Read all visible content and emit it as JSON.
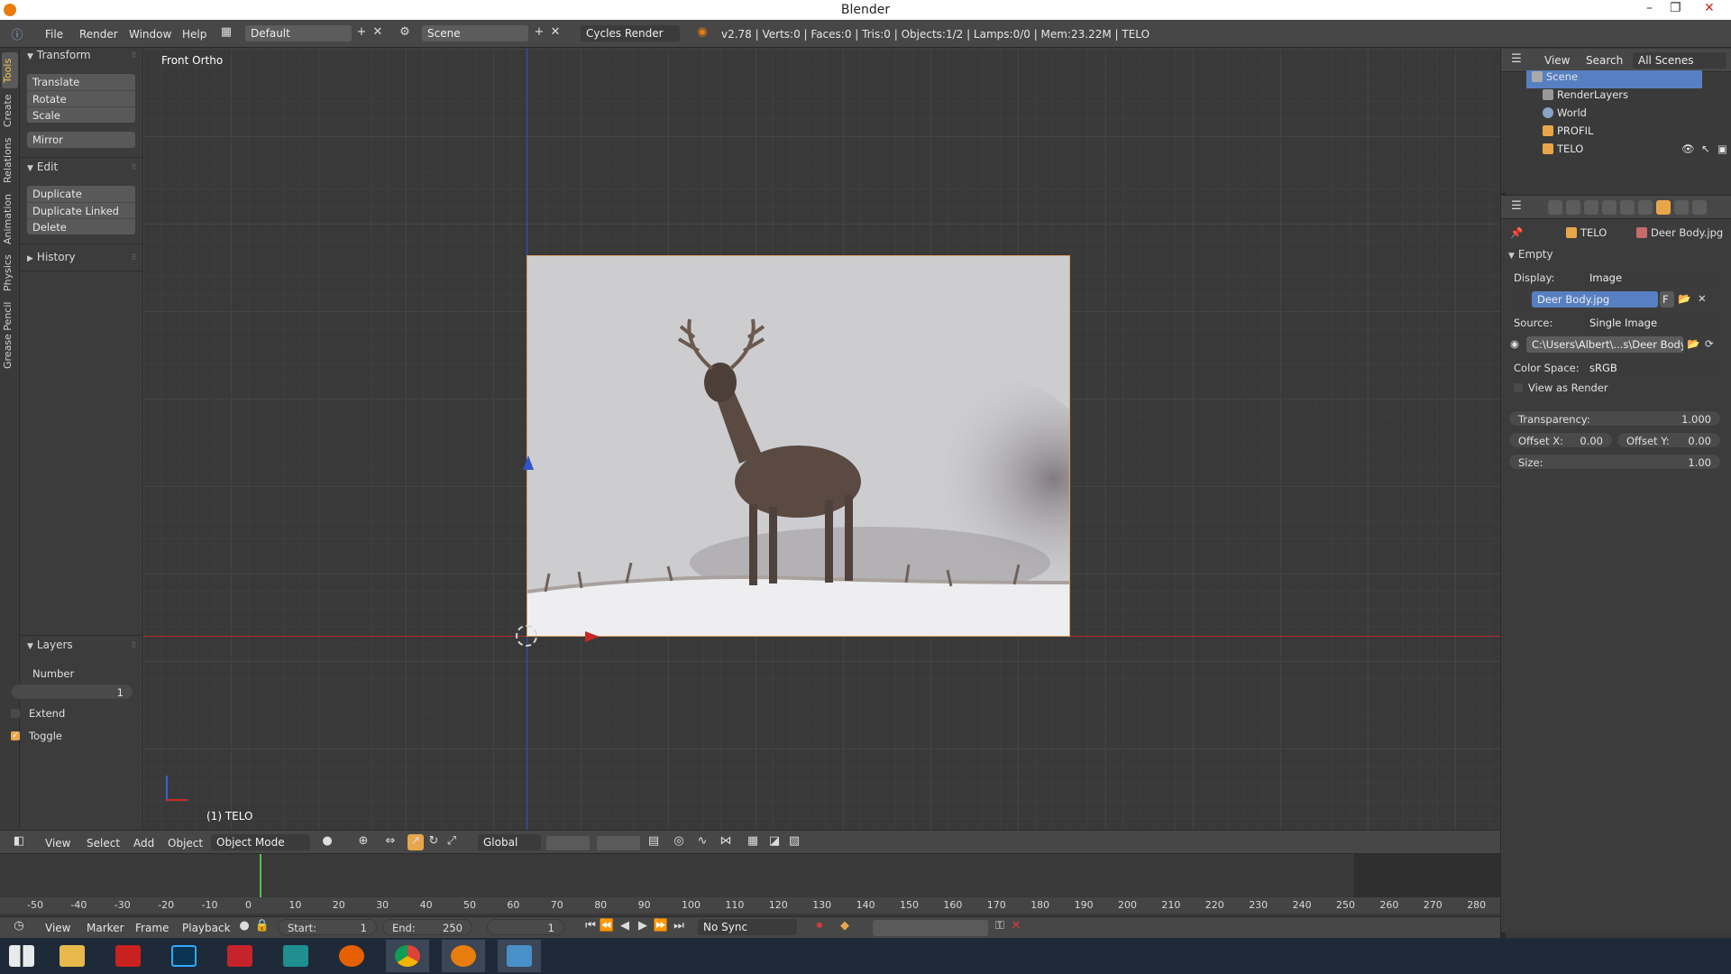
{
  "window": {
    "title": "Blender"
  },
  "menubar": {
    "items": [
      "File",
      "Render",
      "Window",
      "Help"
    ],
    "layout": "Default",
    "scene": "Scene",
    "engine": "Cycles Render",
    "stats": "v2.78 | Verts:0 | Faces:0 | Tris:0 | Objects:1/2 | Lamps:0/0 | Mem:23.22M | TELO"
  },
  "tool_tabs": [
    "Tools",
    "Create",
    "Relations",
    "Animation",
    "Physics",
    "Grease Pencil"
  ],
  "toolshelf": {
    "transform": {
      "title": "Transform",
      "buttons": [
        "Translate",
        "Rotate",
        "Scale",
        "Mirror"
      ]
    },
    "edit": {
      "title": "Edit",
      "buttons": [
        "Duplicate",
        "Duplicate Linked",
        "Delete"
      ]
    },
    "history": {
      "title": "History"
    },
    "layers": {
      "title": "Layers",
      "number_label": "Number",
      "number_value": "1",
      "extend": "Extend",
      "toggle": "Toggle"
    }
  },
  "viewport": {
    "view_label": "Front Ortho",
    "object_label": "(1) TELO"
  },
  "view3d_header": {
    "menus": [
      "View",
      "Select",
      "Add",
      "Object"
    ],
    "mode": "Object Mode",
    "orientation": "Global"
  },
  "timeline": {
    "ticks": [
      "-50",
      "-40",
      "-30",
      "-20",
      "-10",
      "0",
      "10",
      "20",
      "30",
      "40",
      "50",
      "60",
      "70",
      "80",
      "90",
      "100",
      "110",
      "120",
      "130",
      "140",
      "150",
      "160",
      "170",
      "180",
      "190",
      "200",
      "210",
      "220",
      "230",
      "240",
      "250",
      "260",
      "270",
      "280"
    ],
    "menus": [
      "View",
      "Marker",
      "Frame",
      "Playback"
    ],
    "start_label": "Start:",
    "start": "1",
    "end_label": "End:",
    "end": "250",
    "current": "1",
    "sync": "No Sync"
  },
  "outliner": {
    "menus": [
      "View",
      "Search"
    ],
    "filter": "All Scenes",
    "rows": [
      "Scene",
      "RenderLayers",
      "World",
      "PROFIL",
      "TELO"
    ]
  },
  "properties": {
    "context_object": "TELO",
    "context_image": "Deer Body.jpg",
    "panel": "Empty",
    "display_label": "Display:",
    "display_value": "Image",
    "image_name": "Deer Body.jpg",
    "image_flag": "F",
    "source_label": "Source:",
    "source_value": "Single Image",
    "filepath": "C:\\Users\\Albert\\...s\\Deer Body.jpg",
    "colorspace_label": "Color Space:",
    "colorspace_value": "sRGB",
    "view_as_render": "View as Render",
    "transparency_label": "Transparency:",
    "transparency_value": "1.000",
    "offset_x_label": "Offset X:",
    "offset_x_value": "0.00",
    "offset_y_label": "Offset Y:",
    "offset_y_value": "0.00",
    "size_label": "Size:",
    "size_value": "1.00"
  },
  "taskbar": {
    "apps": [
      "windows-start-icon",
      "file-explorer-icon",
      "acrobat-icon",
      "photoshop-icon",
      "sketchup-icon",
      "app-icon",
      "firefox-icon",
      "chrome-icon",
      "blender-icon",
      "window-icon"
    ]
  },
  "colors": {
    "accent_orange": "#e8a64b",
    "selection_blue": "#5680c2",
    "axis_red": "#b62b2b",
    "axis_blue": "#2f55c8",
    "playhead_green": "#55c24b"
  }
}
